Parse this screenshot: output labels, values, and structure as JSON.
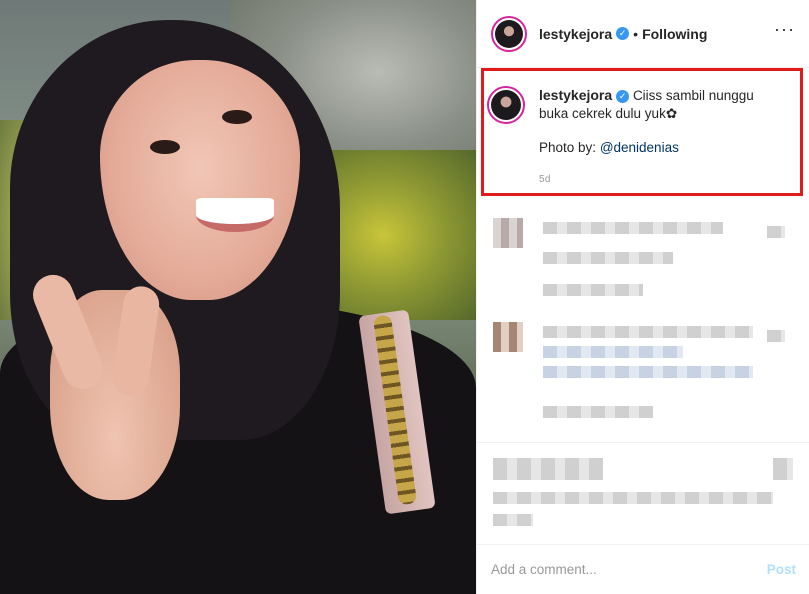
{
  "post": {
    "username": "lestykejora",
    "follow_status": "Following",
    "separator": "•",
    "more_icon": "more-options-icon"
  },
  "caption": {
    "username": "lestykejora",
    "text_line1": "Ciiss sambil nunggu",
    "text_line2": "buka cekrek dulu yuk✿",
    "photo_by_label": "Photo by:",
    "mention": "@denidenias",
    "time": "5d"
  },
  "footer": {
    "placeholder": "Add a comment...",
    "post_label": "Post"
  },
  "colors": {
    "verified_blue": "#3897f0",
    "highlight_red": "#e01b1b",
    "mention_blue": "#003569",
    "post_disabled": "#b2dffc"
  }
}
